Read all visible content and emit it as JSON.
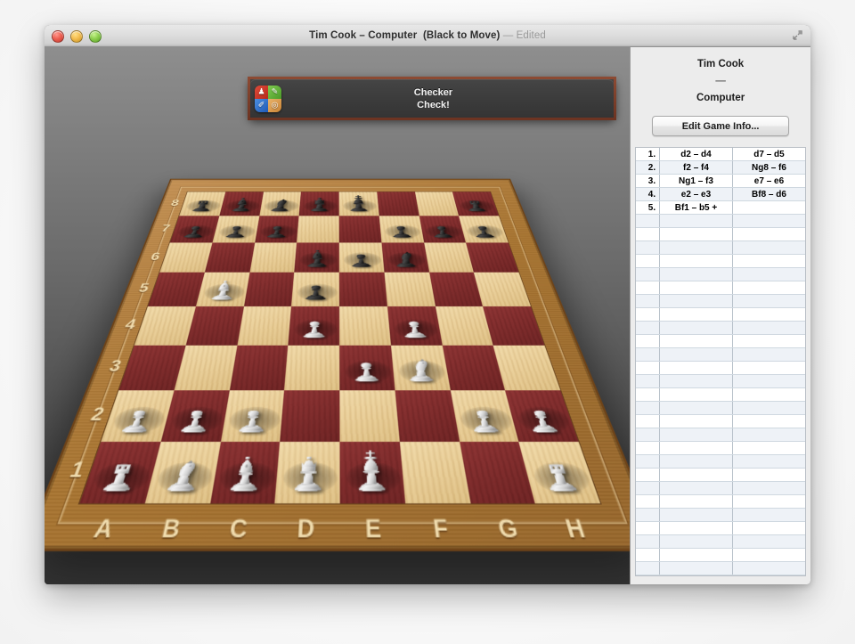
{
  "window": {
    "title_main": "Tim Cook – Computer",
    "title_state": "(Black to Move)",
    "title_edited": "— Edited",
    "traffic": {
      "close": "close-button",
      "minimize": "minimize-button",
      "zoom": "zoom-button"
    },
    "fullscreen": "enter-full-screen"
  },
  "notification": {
    "app_name": "Checker",
    "message": "Check!",
    "icon": {
      "q1": "♟",
      "q2": "✎",
      "q3": "✐",
      "q4": "◎"
    },
    "border_color": "#7c3f2a",
    "bg_color": "#3a3a3a"
  },
  "sidebar": {
    "player_white": "Tim Cook",
    "separator": "—",
    "player_black": "Computer",
    "edit_button": "Edit Game Info...",
    "moves": [
      {
        "num": "1.",
        "white": "d2  –  d4",
        "black": "d7  –  d5"
      },
      {
        "num": "2.",
        "white": "f2  –  f4",
        "black": "Ng8  –  f6"
      },
      {
        "num": "3.",
        "white": "Ng1  –  f3",
        "black": "e7  –  e6"
      },
      {
        "num": "4.",
        "white": "e2  –  e3",
        "black": "Bf8  –  d6"
      },
      {
        "num": "5.",
        "white": "Bf1  –  b5 +",
        "black": ""
      },
      {
        "num": "",
        "white": "",
        "black": ""
      },
      {
        "num": "",
        "white": "",
        "black": ""
      },
      {
        "num": "",
        "white": "",
        "black": ""
      },
      {
        "num": "",
        "white": "",
        "black": ""
      },
      {
        "num": "",
        "white": "",
        "black": ""
      },
      {
        "num": "",
        "white": "",
        "black": ""
      },
      {
        "num": "",
        "white": "",
        "black": ""
      },
      {
        "num": "",
        "white": "",
        "black": ""
      },
      {
        "num": "",
        "white": "",
        "black": ""
      },
      {
        "num": "",
        "white": "",
        "black": ""
      },
      {
        "num": "",
        "white": "",
        "black": ""
      },
      {
        "num": "",
        "white": "",
        "black": ""
      },
      {
        "num": "",
        "white": "",
        "black": ""
      },
      {
        "num": "",
        "white": "",
        "black": ""
      },
      {
        "num": "",
        "white": "",
        "black": ""
      },
      {
        "num": "",
        "white": "",
        "black": ""
      },
      {
        "num": "",
        "white": "",
        "black": ""
      },
      {
        "num": "",
        "white": "",
        "black": ""
      },
      {
        "num": "",
        "white": "",
        "black": ""
      },
      {
        "num": "",
        "white": "",
        "black": ""
      },
      {
        "num": "",
        "white": "",
        "black": ""
      },
      {
        "num": "",
        "white": "",
        "black": ""
      },
      {
        "num": "",
        "white": "",
        "black": ""
      },
      {
        "num": "",
        "white": "",
        "black": ""
      },
      {
        "num": "",
        "white": "",
        "black": ""
      },
      {
        "num": "",
        "white": "",
        "black": ""
      },
      {
        "num": "",
        "white": "",
        "black": ""
      },
      {
        "num": "",
        "white": "",
        "black": ""
      },
      {
        "num": "",
        "white": "",
        "black": ""
      }
    ]
  },
  "board": {
    "files": [
      "A",
      "B",
      "C",
      "D",
      "E",
      "F",
      "G",
      "H"
    ],
    "ranks": [
      "8",
      "7",
      "6",
      "5",
      "4",
      "3",
      "2",
      "1"
    ],
    "light_square_color": "#e8cc95",
    "dark_square_color": "#7e2c2c",
    "frame_color": "#b4803f",
    "pieces": [
      {
        "square": "a8",
        "color": "black",
        "type": "rook"
      },
      {
        "square": "b8",
        "color": "black",
        "type": "bishop"
      },
      {
        "square": "c8",
        "color": "black",
        "type": "knight"
      },
      {
        "square": "d8",
        "color": "black",
        "type": "queen"
      },
      {
        "square": "e8",
        "color": "black",
        "type": "king"
      },
      {
        "square": "h8",
        "color": "black",
        "type": "rook"
      },
      {
        "square": "a7",
        "color": "black",
        "type": "pawn"
      },
      {
        "square": "b7",
        "color": "black",
        "type": "pawn"
      },
      {
        "square": "c7",
        "color": "black",
        "type": "pawn"
      },
      {
        "square": "f7",
        "color": "black",
        "type": "pawn"
      },
      {
        "square": "g7",
        "color": "black",
        "type": "pawn"
      },
      {
        "square": "h7",
        "color": "black",
        "type": "pawn"
      },
      {
        "square": "d6",
        "color": "black",
        "type": "bishop"
      },
      {
        "square": "e6",
        "color": "black",
        "type": "pawn"
      },
      {
        "square": "f6",
        "color": "black",
        "type": "knight"
      },
      {
        "square": "d5",
        "color": "black",
        "type": "pawn"
      },
      {
        "square": "b5",
        "color": "white",
        "type": "bishop"
      },
      {
        "square": "d4",
        "color": "white",
        "type": "pawn"
      },
      {
        "square": "f4",
        "color": "white",
        "type": "pawn"
      },
      {
        "square": "e3",
        "color": "white",
        "type": "pawn"
      },
      {
        "square": "f3",
        "color": "white",
        "type": "knight"
      },
      {
        "square": "a2",
        "color": "white",
        "type": "pawn"
      },
      {
        "square": "b2",
        "color": "white",
        "type": "pawn"
      },
      {
        "square": "c2",
        "color": "white",
        "type": "pawn"
      },
      {
        "square": "g2",
        "color": "white",
        "type": "pawn"
      },
      {
        "square": "h2",
        "color": "white",
        "type": "pawn"
      },
      {
        "square": "a1",
        "color": "white",
        "type": "rook"
      },
      {
        "square": "b1",
        "color": "white",
        "type": "knight"
      },
      {
        "square": "c1",
        "color": "white",
        "type": "bishop"
      },
      {
        "square": "d1",
        "color": "white",
        "type": "queen"
      },
      {
        "square": "e1",
        "color": "white",
        "type": "king"
      },
      {
        "square": "h1",
        "color": "white",
        "type": "rook"
      }
    ]
  }
}
